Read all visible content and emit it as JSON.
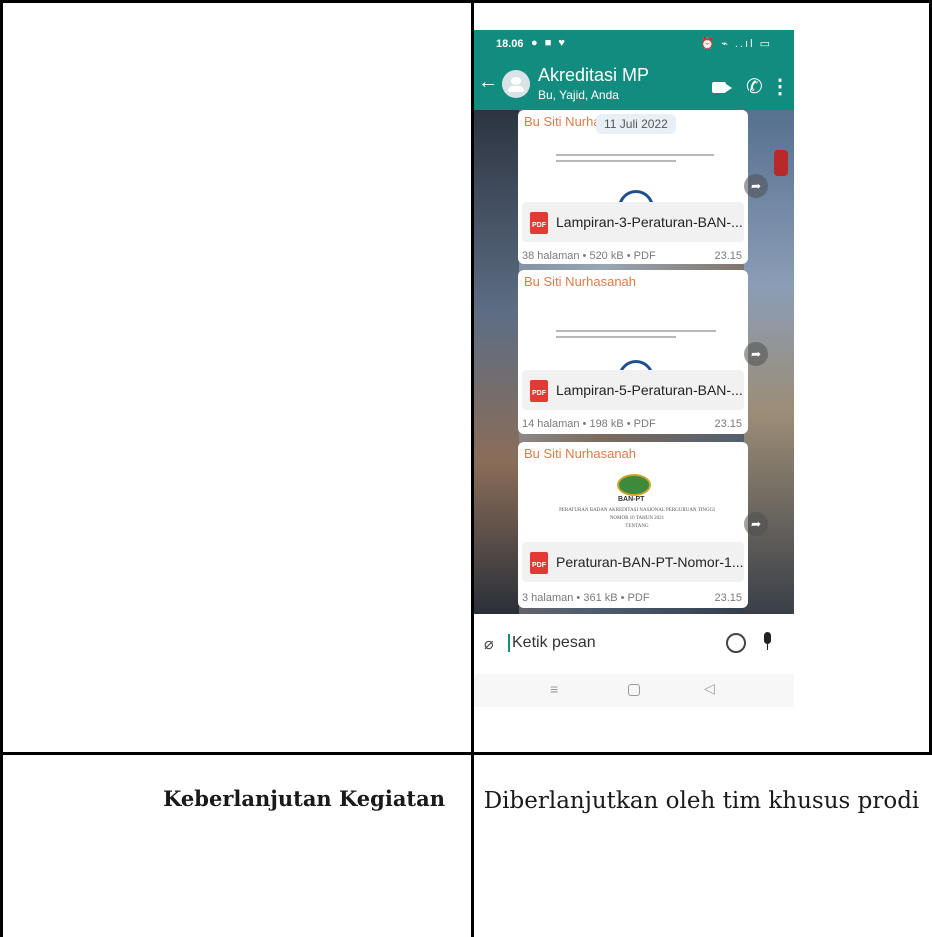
{
  "phone": {
    "status": {
      "time": "18.06",
      "left_icons": "● ■ ♥",
      "right_icons": "⏰ ⌁ ..ıl ▭"
    },
    "header": {
      "title": "Akreditasi MP",
      "subtitle": "Bu, Yajid, Anda"
    },
    "date_chip": "11 Juli 2022",
    "messages": [
      {
        "sender": "Bu Siti Nurha",
        "file_name": "Lampiran-3-Peraturan-BAN-...",
        "meta": "38 halaman • 520 kB • PDF",
        "time": "23.15"
      },
      {
        "sender": "Bu Siti Nurhasanah",
        "file_name": "Lampiran-5-Peraturan-BAN-...",
        "meta": "14 halaman • 198 kB • PDF",
        "time": "23.15"
      },
      {
        "sender": "Bu Siti Nurhasanah",
        "file_name": "Peraturan-BAN-PT-Nomor-1...",
        "meta": "3 halaman • 361 kB • PDF",
        "time": "23.15",
        "preview_logo": "BAN-PT",
        "preview_lines": [
          "PERATURAN BADAN AKREDITASI NASIONAL PERGURUAN TINGGI",
          "NOMOR 10 TAHUN 2021",
          "TENTANG"
        ]
      }
    ],
    "pdf_badge": "PDF",
    "input_placeholder": "Ketik pesan",
    "icons": [
      "back-arrow-icon",
      "group-avatar-icon",
      "video-call-icon",
      "phone-call-icon",
      "more-menu-icon",
      "forward-icon",
      "pdf-icon",
      "attach-icon",
      "emoji-icon",
      "mic-icon",
      "nav-menu-icon",
      "nav-home-icon",
      "nav-back-icon"
    ]
  },
  "table": {
    "row_label": "Keberlanjutan Kegiatan",
    "row_value": "Diberlanjutkan oleh tim khusus prodi"
  }
}
